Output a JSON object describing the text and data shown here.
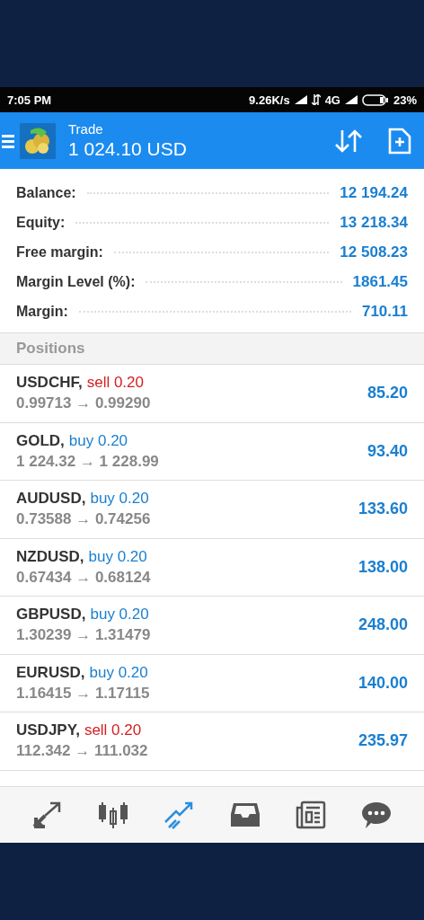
{
  "status_bar": {
    "time": "7:05 PM",
    "speed": "9.26K/s",
    "network": "4G",
    "battery": "23%"
  },
  "app_bar": {
    "title": "Trade",
    "subtitle": "1 024.10 USD"
  },
  "summary": [
    {
      "label": "Balance:",
      "value": "12 194.24"
    },
    {
      "label": "Equity:",
      "value": "13 218.34"
    },
    {
      "label": "Free margin:",
      "value": "12 508.23"
    },
    {
      "label": "Margin Level (%):",
      "value": "1861.45"
    },
    {
      "label": "Margin:",
      "value": "710.11"
    }
  ],
  "positions_header": "Positions",
  "positions": [
    {
      "symbol": "USDCHF,",
      "kind": "sell",
      "order": "sell 0.20",
      "prices": "0.99713 → 0.99290",
      "profit": "85.20"
    },
    {
      "symbol": "GOLD,",
      "kind": "buy",
      "order": "buy 0.20",
      "prices": "1 224.32 → 1 228.99",
      "profit": "93.40"
    },
    {
      "symbol": "AUDUSD,",
      "kind": "buy",
      "order": "buy 0.20",
      "prices": "0.73588 → 0.74256",
      "profit": "133.60"
    },
    {
      "symbol": "NZDUSD,",
      "kind": "buy",
      "order": "buy 0.20",
      "prices": "0.67434 → 0.68124",
      "profit": "138.00"
    },
    {
      "symbol": "GBPUSD,",
      "kind": "buy",
      "order": "buy 0.20",
      "prices": "1.30239 → 1.31479",
      "profit": "248.00"
    },
    {
      "symbol": "EURUSD,",
      "kind": "buy",
      "order": "buy 0.20",
      "prices": "1.16415 → 1.17115",
      "profit": "140.00"
    },
    {
      "symbol": "USDJPY,",
      "kind": "sell",
      "order": "sell 0.20",
      "prices": "112.342 → 111.032",
      "profit": "235.97"
    }
  ],
  "bottom_nav": [
    {
      "kind": "quotes",
      "selected": false
    },
    {
      "kind": "chart",
      "selected": false
    },
    {
      "kind": "trade",
      "selected": true
    },
    {
      "kind": "history",
      "selected": false
    },
    {
      "kind": "news",
      "selected": false
    },
    {
      "kind": "chat",
      "selected": false
    }
  ]
}
